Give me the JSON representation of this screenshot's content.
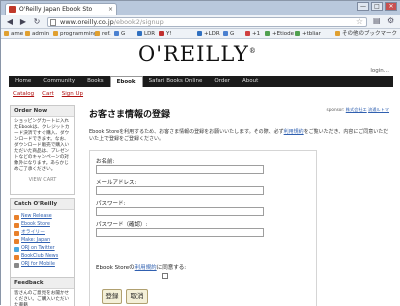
{
  "browser": {
    "tab_title": "O'Reilly Japan Ebook Sto",
    "tab_close": "×",
    "window_buttons": [
      "—",
      "□",
      "✕"
    ],
    "url_host": "www.oreilly.co.jp",
    "url_path": "/ebook2/signup",
    "bookmarks": [
      "ame",
      "admin",
      "programming",
      "ref.",
      "G",
      "LDR",
      "Y!",
      "+LDR",
      "G",
      "+1",
      "+Etiode",
      "+tbliar"
    ],
    "other_bookmarks": "その他のブックマーク",
    "brand_colors": {
      "titlebar": "#b9c8dc",
      "toolbar": "#eef2f7"
    }
  },
  "site": {
    "logo": "O'REILLY",
    "logo_mark": "®",
    "login": "login...",
    "nav": [
      "Home",
      "Community",
      "Books",
      "Ebook",
      "Safari Books Online",
      "Order",
      "About"
    ],
    "active_nav": "Ebook",
    "subnav": [
      "Catalog",
      "Cart",
      "Sign Up"
    ]
  },
  "sidebar": {
    "order_now": {
      "title": "Order Now",
      "body": "ショッピングカートに入れたEbookは、クレジットカード決済ですぐ購入、ダウンロードできます。なお、ダウンロード販売で購入いただいた商品は、プレゼントなどのキャンペーンの対象外になります。あらかじめご了承ください。",
      "cart_icon": "VIEW CART"
    },
    "catch": {
      "title": "Catch O'Reilly",
      "links": [
        "New Release",
        "Ebook Store",
        "オライリー",
        "Make: Japan",
        "ORJ on Twitter",
        "BookClub News",
        "ORJ for Mobile"
      ]
    },
    "feedback": {
      "title": "Feedback",
      "body": "皆さんのご意見をお聞かせください。ご購入いただいた書籍"
    }
  },
  "main": {
    "title": "お客さま情報の登録",
    "sponsor_label": "sponsor:",
    "sponsor_links": [
      "株式会社エ",
      "流通ルトマ"
    ],
    "intro_prefix": "Ebook Storeを利用するため、お客さま情報の登録をお願いいたします。その際、必ず",
    "intro_link": "利用規約",
    "intro_suffix": "をご覧いただき、内容にご同意いただいた上で登録をご登録ください。",
    "form": {
      "name_label": "お名前:",
      "email_label": "メールアドレス:",
      "password_label": "パスワード:",
      "password_confirm_label": "パスワード（確認）:",
      "agree_prefix": "Ebook Storeの",
      "agree_link": "利用規約",
      "agree_suffix": "に同意する:",
      "submit": "登録",
      "cancel": "取消"
    }
  }
}
